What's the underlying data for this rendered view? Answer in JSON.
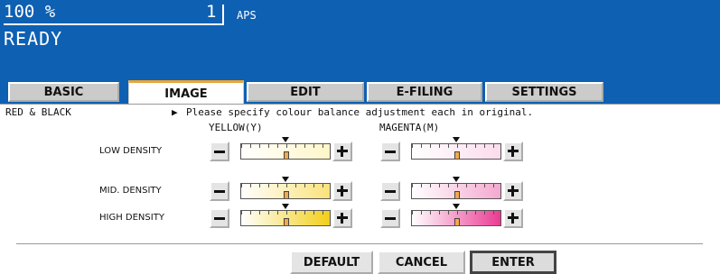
{
  "header": {
    "copies": "100 %",
    "count": "1",
    "paper": "APS",
    "status": "READY",
    "bg_color": "#0e60b2"
  },
  "tabs": [
    {
      "label": "BASIC",
      "active": false
    },
    {
      "label": "IMAGE",
      "active": true
    },
    {
      "label": "EDIT",
      "active": false
    },
    {
      "label": "E-FILING",
      "active": false
    },
    {
      "label": "SETTINGS",
      "active": false
    }
  ],
  "panel": {
    "mode": "RED & BLACK",
    "instruction": "Please specify colour balance adjustment each in original.",
    "instruction_icon": "right-triangle-icon",
    "col_yellow": "YELLOW(Y)",
    "col_magenta": "MAGENTA(M)",
    "rows": [
      {
        "label": "LOW DENSITY",
        "yellow_level": 0.5,
        "magenta_level": 0.5
      },
      {
        "label": "MID. DENSITY",
        "yellow_level": 0.5,
        "magenta_level": 0.5
      },
      {
        "label": "HIGH DENSITY",
        "yellow_level": 0.5,
        "magenta_level": 0.5
      }
    ],
    "minus_icon": "minus-icon",
    "plus_icon": "plus-icon",
    "yellow_colors": [
      "#fff6c8",
      "#fbe27a",
      "#f2cf1a"
    ],
    "magenta_colors": [
      "#fbdcec",
      "#f4a8cf",
      "#ea3b94"
    ]
  },
  "actions": {
    "default": "DEFAULT",
    "cancel": "CANCEL",
    "enter": "ENTER"
  }
}
